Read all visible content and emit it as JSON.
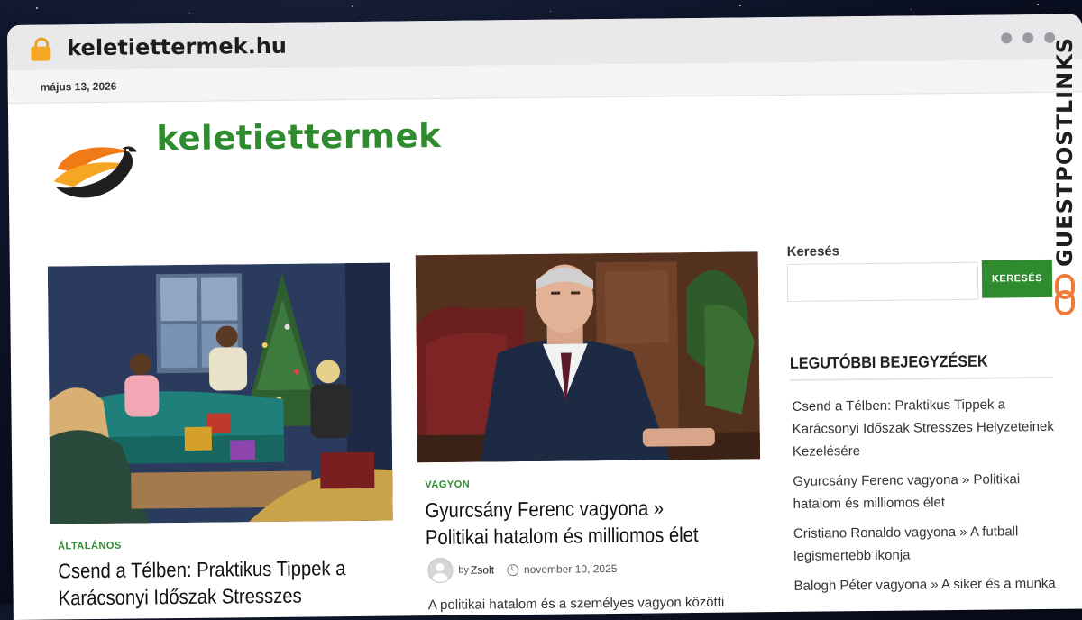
{
  "browser": {
    "url": "keletiettermek.hu"
  },
  "topbar": {
    "date": "május 13, 2026"
  },
  "site": {
    "title": "keletiettermek"
  },
  "posts": [
    {
      "category": "ÁLTALÁNOS",
      "title": "Csend a Télben: Praktikus Tippek a Karácsonyi Időszak Stresszes"
    },
    {
      "category": "VAGYON",
      "title": "Gyurcsány Ferenc vagyona » Politikai hatalom és milliomos élet",
      "author_prefix": "by",
      "author": "Zsolt",
      "date": "november 10, 2025",
      "excerpt": "A politikai hatalom és a személyes vagyon közötti"
    }
  ],
  "sidebar": {
    "search_label": "Keresés",
    "search_button": "KERESÉS",
    "recent_heading": "LEGUTÓBBI BEJEGYZÉSEK",
    "recent_posts": [
      "Csend a Télben: Praktikus Tippek a Karácsonyi Időszak Stresszes Helyzeteinek Kezelésére",
      "Gyurcsány Ferenc vagyona » Politikai hatalom és milliomos élet",
      "Cristiano Ronaldo vagyona » A futball legismertebb ikonja",
      "Balogh Péter vagyona » A siker és a munka"
    ]
  },
  "watermark": {
    "text": "GUESTPOSTLINKS"
  },
  "colors": {
    "accent": "#2e8b2e",
    "lock": "#f5a623"
  }
}
